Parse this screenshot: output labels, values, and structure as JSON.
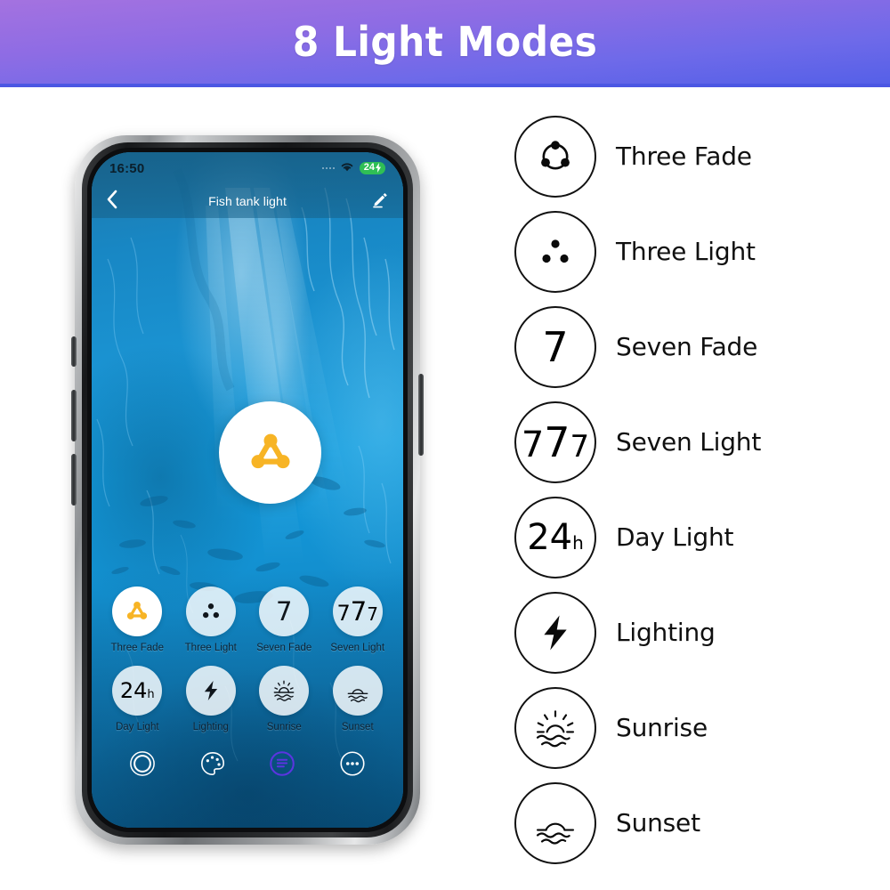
{
  "banner": {
    "title": "8 Light Modes",
    "gradient_from": "#a472e0",
    "gradient_to": "#5560e8",
    "text_color": "#ffffff"
  },
  "phone": {
    "status": {
      "time": "16:50",
      "wifi_icon": "wifi-icon",
      "battery_level": "24",
      "battery_charging_icon": "bolt-icon",
      "battery_color": "#2fbf55"
    },
    "nav": {
      "back_icon": "chevron-left-icon",
      "title": "Fish tank light",
      "edit_icon": "pencil-icon"
    },
    "big_button": {
      "icon": "three-fade-icon",
      "icon_color": "#f7b425",
      "background": "#ffffff"
    },
    "grid": {
      "items": [
        {
          "label": "Three Fade",
          "icon": "three-fade-icon",
          "active": true
        },
        {
          "label": "Three Light",
          "icon": "three-light-icon",
          "active": false
        },
        {
          "label": "Seven Fade",
          "icon": "seven-fade-icon",
          "active": false
        },
        {
          "label": "Seven Light",
          "icon": "seven-light-icon",
          "active": false
        },
        {
          "label": "Day Light",
          "icon": "day-light-icon",
          "active": false
        },
        {
          "label": "Lighting",
          "icon": "lighting-icon",
          "active": false
        },
        {
          "label": "Sunrise",
          "icon": "sunrise-icon",
          "active": false
        },
        {
          "label": "Sunset",
          "icon": "sunset-icon",
          "active": false
        }
      ]
    },
    "tabs": [
      {
        "name": "power-tab",
        "icon": "power-circle-icon",
        "active": false
      },
      {
        "name": "color-tab",
        "icon": "palette-icon",
        "active": false
      },
      {
        "name": "scene-tab",
        "icon": "scene-list-icon",
        "active": true
      },
      {
        "name": "more-tab",
        "icon": "more-dots-icon",
        "active": false
      }
    ],
    "active_tab_color": "#5b35e0"
  },
  "mode_list": [
    {
      "label": "Three Fade",
      "icon": "three-fade-icon"
    },
    {
      "label": "Three Light",
      "icon": "three-light-icon"
    },
    {
      "label": "Seven Fade",
      "icon": "seven-fade-icon",
      "glyph": "7"
    },
    {
      "label": "Seven Light",
      "icon": "seven-light-icon",
      "glyph_a": "7",
      "glyph_b": "7",
      "glyph_c": "7"
    },
    {
      "label": "Day Light",
      "icon": "day-light-icon",
      "glyph_big": "24",
      "glyph_small": "h"
    },
    {
      "label": "Lighting",
      "icon": "lighting-icon"
    },
    {
      "label": "Sunrise",
      "icon": "sunrise-icon"
    },
    {
      "label": "Sunset",
      "icon": "sunset-icon"
    }
  ]
}
